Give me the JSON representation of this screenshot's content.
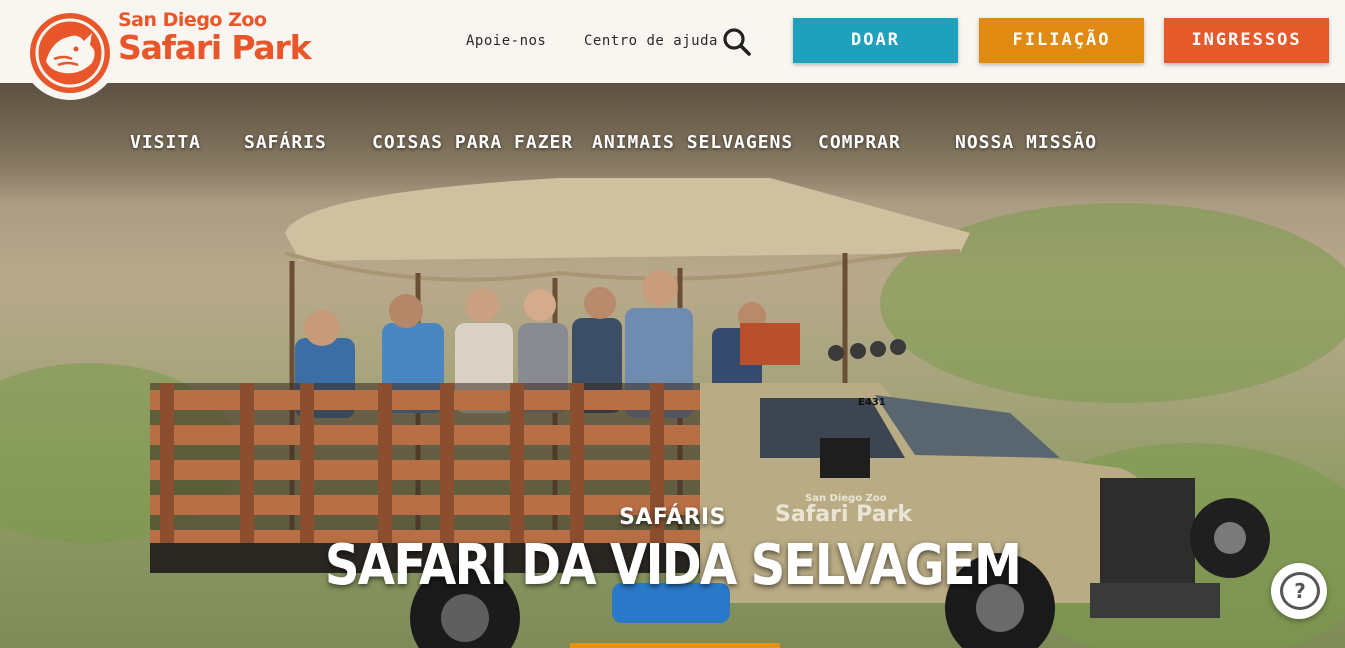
{
  "header": {
    "logo": {
      "line1": "San Diego Zoo",
      "line2": "Safari Park"
    },
    "utility_links": [
      {
        "label": "Apoie-nos"
      },
      {
        "label": "Centro de ajuda"
      }
    ],
    "search_icon": "search-icon",
    "cta_buttons": [
      {
        "label": "DOAR",
        "color": "#1fa1bd"
      },
      {
        "label": "FILIAÇÃO",
        "color": "#e08a12"
      },
      {
        "label": "INGRESSOS",
        "color": "#e55a2b"
      }
    ]
  },
  "nav": {
    "items": [
      {
        "label": "VISITA"
      },
      {
        "label": "SAFÁRIS"
      },
      {
        "label": "COISAS PARA FAZER"
      },
      {
        "label": "ANIMAIS SELVAGENS"
      },
      {
        "label": "COMPRAR"
      },
      {
        "label": "NOSSA MISSÃO"
      }
    ]
  },
  "hero": {
    "kicker": "SAFÁRIS",
    "title": "SAFARI DA VIDA SELVAGEM",
    "truck_door_logo": "San Diego Zoo Safari Park",
    "truck_number": "E431"
  },
  "help": {
    "icon": "help-icon",
    "label": "?"
  },
  "colors": {
    "brand": "#e8562a",
    "cta_peek": "#e8900f"
  }
}
